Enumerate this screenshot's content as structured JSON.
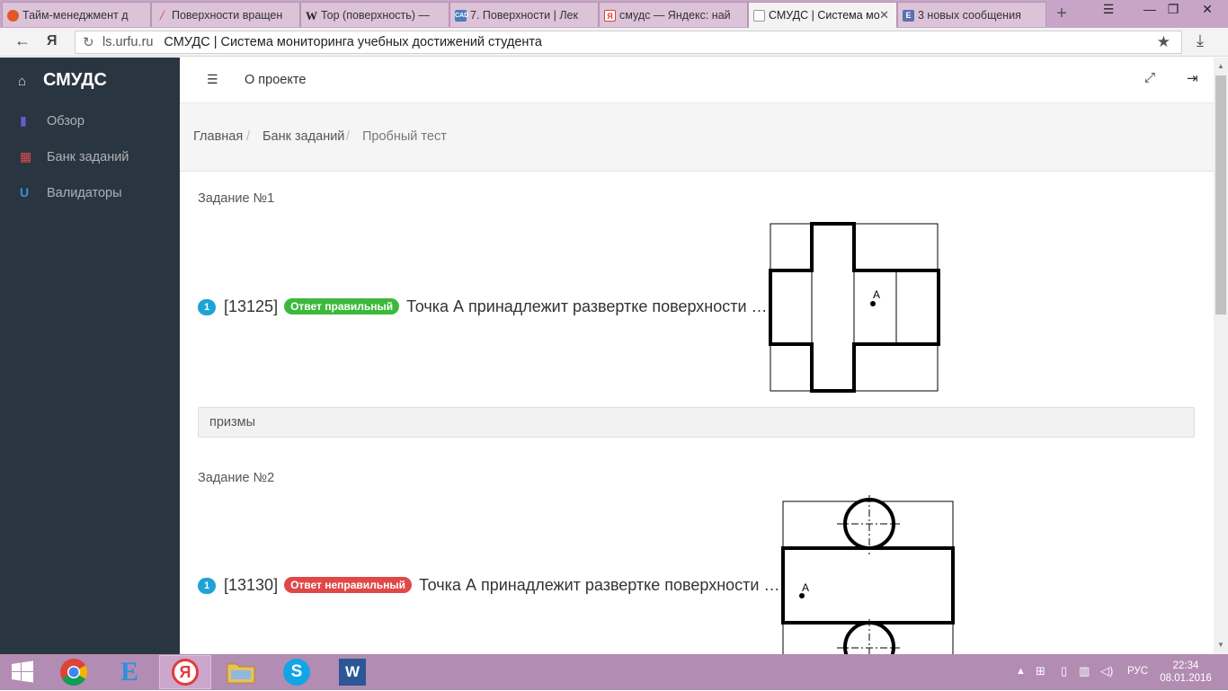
{
  "browser": {
    "tabs": [
      {
        "title": "Тайм-менеджмент д",
        "icon_color": "#e2572a",
        "icon": "clock-icon"
      },
      {
        "title": "Поверхности вращен",
        "icon_color": "#888888",
        "icon": "pen-icon"
      },
      {
        "title": "Тор (поверхность) —",
        "icon_color": "#555555",
        "icon": "wikipedia-icon"
      },
      {
        "title": "7. Поверхности | Лек",
        "icon_color": "#4a7ebb",
        "icon": "cad-icon"
      },
      {
        "title": "смудс — Яндекс: най",
        "icon_color": "#e23b3b",
        "icon": "yandex-icon"
      },
      {
        "title": "СМУДС | Система мо",
        "icon_color": "#999999",
        "icon": "page-icon"
      },
      {
        "title": "3 новых сообщения",
        "icon_color": "#5b6fb0",
        "icon": "mail-icon"
      }
    ],
    "address_host": "ls.urfu.ru",
    "address_title": "СМУДС | Система мониторинга учебных достижений студента",
    "tab_icons": {
      "cad": "CAD",
      "w": "W",
      "ya": "Я",
      "e": "Е"
    }
  },
  "sidebar": {
    "brand": "СМУДС",
    "items": [
      {
        "label": "Обзор",
        "icon": "bar-chart-icon",
        "color": "#6a5acd"
      },
      {
        "label": "Банк заданий",
        "icon": "bank-icon",
        "color": "#e04b4b"
      },
      {
        "label": "Валидаторы",
        "icon": "magnet-icon",
        "color": "#3a8fd6"
      }
    ]
  },
  "topnav": {
    "about": "О проекте"
  },
  "breadcrumb": [
    "Главная",
    "Банк заданий",
    "Пробный тест"
  ],
  "tasks": [
    {
      "title": "Задание №1",
      "num": "1",
      "code": "[13125]",
      "status": "Ответ правильный",
      "status_color": "#3cb93c",
      "question": "Точка А принадлежит развертке поверхности …",
      "answer": "призмы",
      "figure_label": "A"
    },
    {
      "title": "Задание №2",
      "num": "1",
      "code": "[13130]",
      "status": "Ответ неправильный",
      "status_color": "#e04848",
      "question": "Точка А принадлежит развертке поверхности …",
      "figure_label": "A"
    }
  ],
  "taskbar": {
    "lang": "РУС",
    "time": "22:34",
    "date": "08.01.2016"
  }
}
